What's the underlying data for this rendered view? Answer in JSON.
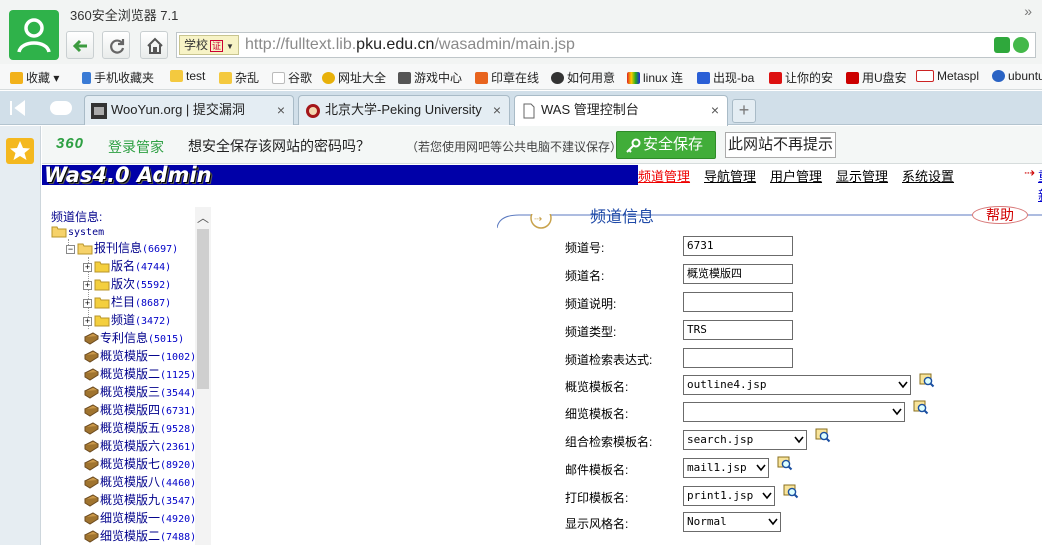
{
  "window": {
    "title": "360安全浏览器 7.1",
    "more": "»"
  },
  "address": {
    "zone": "学校",
    "cert": "证",
    "url_prefix": "http://fulltext.lib.",
    "url_domain": "pku.edu.cn",
    "url_path": "/wasadmin/main.jsp"
  },
  "bookmarks": [
    "收藏",
    "手机收藏夹",
    "test",
    "杂乱",
    "谷歌",
    "网址大全",
    "游戏中心",
    "印章在线",
    "如何用意",
    "linux 连",
    "出现-ba",
    "让你的安",
    "用U盘安",
    "Metaspl",
    "ubuntu"
  ],
  "tabs": [
    {
      "label": "WooYun.org | 提交漏洞",
      "close": "×"
    },
    {
      "label": "北京大学-Peking University",
      "close": "×"
    },
    {
      "label": "WAS 管理控制台",
      "close": "×"
    }
  ],
  "new_tab": "+",
  "password_bar": {
    "brand": "360",
    "brand2": "登录管家",
    "question": "想安全保存该网站的密码吗？",
    "note": "（若您使用网吧等公共电脑不建议保存）",
    "save": "安全保存",
    "never": "此网站不再提示"
  },
  "was": {
    "logo": "Was4.0 Admin",
    "menu": [
      "频道管理",
      "导航管理",
      "用户管理",
      "显示管理",
      "系统设置"
    ],
    "menu_arrow": "⇢",
    "menu_last": "重新"
  },
  "tree": {
    "title": "频道信息:",
    "root": "system",
    "group": {
      "label": "报刊信息",
      "count": "(6697)"
    },
    "children": [
      {
        "label": "版名",
        "count": "(4744)"
      },
      {
        "label": "版次",
        "count": "(5592)"
      },
      {
        "label": "栏目",
        "count": "(8687)"
      },
      {
        "label": "频道",
        "count": "(3472)"
      }
    ],
    "items": [
      {
        "label": "专利信息",
        "count": "(5015)"
      },
      {
        "label": "概览模版一",
        "count": "(1002)"
      },
      {
        "label": "概览模版二",
        "count": "(1125)"
      },
      {
        "label": "概览模版三",
        "count": "(3544)"
      },
      {
        "label": "概览模版四",
        "count": "(6731)"
      },
      {
        "label": "概览模版五",
        "count": "(9528)"
      },
      {
        "label": "概览模版六",
        "count": "(2361)"
      },
      {
        "label": "概览模版七",
        "count": "(8920)"
      },
      {
        "label": "概览模版八",
        "count": "(4460)"
      },
      {
        "label": "概览模版九",
        "count": "(3547)"
      },
      {
        "label": "细览模版一",
        "count": "(4920)"
      },
      {
        "label": "细览模版二",
        "count": "(7488)"
      }
    ]
  },
  "form": {
    "section_title": "频道信息",
    "help": "帮助",
    "fields": [
      {
        "label": "频道号:",
        "value": "6731"
      },
      {
        "label": "频道名:",
        "value": "概览模版四"
      },
      {
        "label": "频道说明:",
        "value": ""
      },
      {
        "label": "频道类型:",
        "value": "TRS"
      },
      {
        "label": "频道检索表达式:",
        "value": ""
      },
      {
        "label": "概览模板名:",
        "value": "outline4.jsp"
      },
      {
        "label": "细览模板名:",
        "value": ""
      },
      {
        "label": "组合检索模板名:",
        "value": "search.jsp"
      },
      {
        "label": "邮件模板名:",
        "value": "mail1.jsp"
      },
      {
        "label": "打印模板名:",
        "value": "print1.jsp"
      },
      {
        "label": "显示风格名:",
        "value": "Normal"
      }
    ]
  }
}
